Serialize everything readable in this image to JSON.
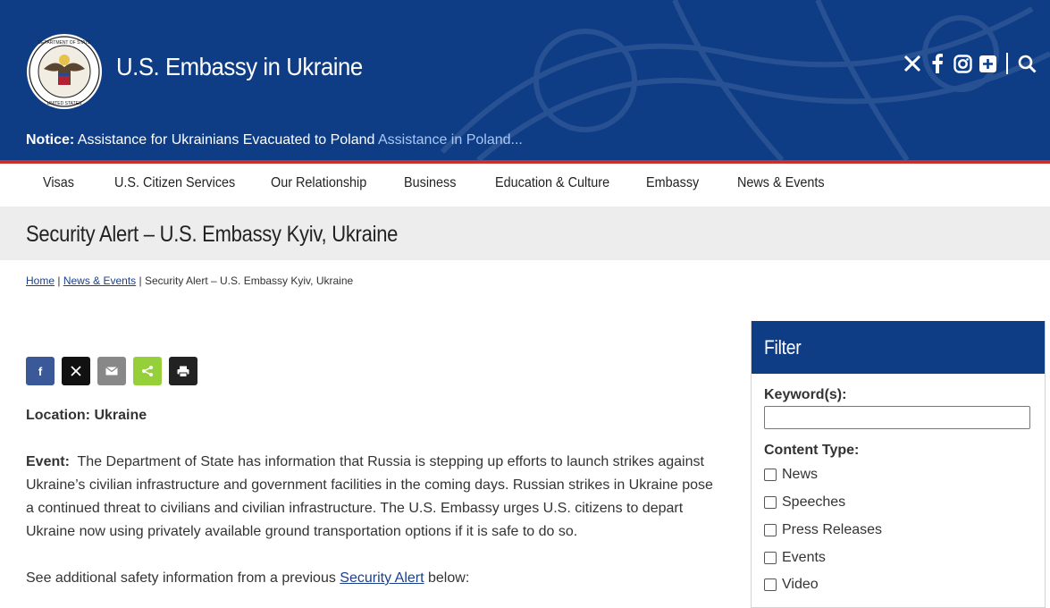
{
  "header": {
    "site_title": "U.S. Embassy in Ukraine",
    "notice_label": "Notice:",
    "notice_text": " Assistance for Ukrainians Evacuated to Poland ",
    "notice_link": "Assistance in Poland..."
  },
  "nav": {
    "items": [
      "Visas",
      "U.S. Citizen Services",
      "Our Relationship",
      "Business",
      "Education & Culture",
      "Embassy",
      "News & Events"
    ]
  },
  "page": {
    "title": "Security Alert – U.S. Embassy Kyiv, Ukraine"
  },
  "breadcrumb": {
    "home": "Home",
    "sep1": " | ",
    "news": "News & Events",
    "sep2": " | ",
    "current": "Security Alert – U.S. Embassy Kyiv, Ukraine"
  },
  "share": {
    "facebook": "f",
    "x": "𝕏",
    "email": "✉",
    "sharethis": "<",
    "print": "⎙"
  },
  "article": {
    "location_label": "Location:",
    "location_value": " Ukraine",
    "event_label": "Event:",
    "event_text": "  The Department of State has information that Russia is stepping up efforts to launch strikes against Ukraine’s civilian infrastructure and government facilities in the coming days. Russian strikes in Ukraine pose a continued threat to civilians and civilian infrastructure. The U.S. Embassy urges U.S. citizens to depart Ukraine now using privately available ground transportation options if it is safe to do so.",
    "additional_prefix": "See additional safety information from a previous ",
    "additional_link": "Security Alert",
    "additional_suffix": " below:"
  },
  "filter": {
    "title": "Filter",
    "keyword_label": "Keyword(s):",
    "content_type_label": "Content Type:",
    "options": [
      "News",
      "Speeches",
      "Press Releases",
      "Events",
      "Video"
    ]
  },
  "colors": {
    "header_blue": "#0e3d86",
    "accent_red": "#c8302c",
    "link_blue": "#1b3f8b",
    "band_gray": "#ededed"
  }
}
